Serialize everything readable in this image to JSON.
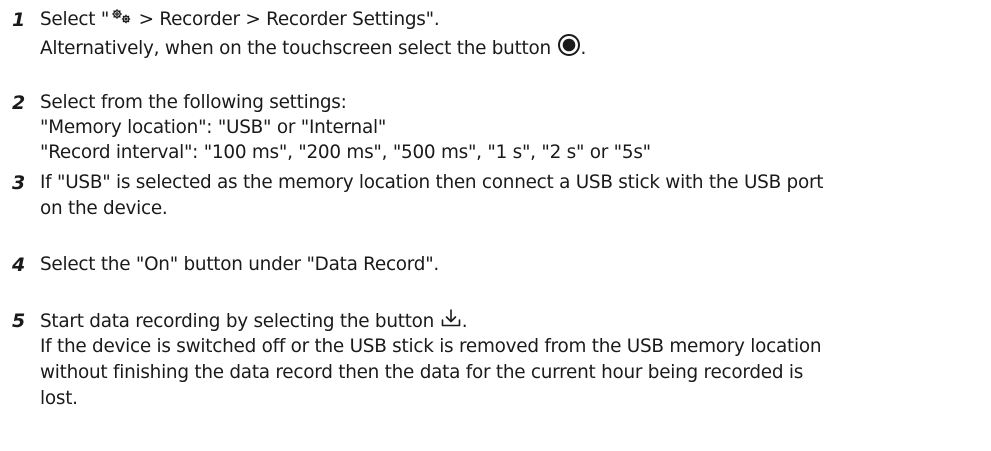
{
  "steps": [
    {
      "number": "1",
      "lines": [
        {
          "pre": "Select \"",
          "post": " > Recorder > Recorder Settings\"."
        },
        {
          "pre": "Alternatively, when on the touchscreen select the button ",
          "post": "."
        }
      ]
    },
    {
      "number": "2",
      "lines": [
        "Select from the following settings:",
        "\"Memory location\": \"USB\" or \"Internal\"",
        "\"Record interval\": \"100 ms\", \"200 ms\", \"500 ms\", \"1 s\", \"2 s\" or \"5s\""
      ]
    },
    {
      "number": "3",
      "lines": [
        "If \"USB\" is selected as the memory location then connect a USB stick with the USB port",
        "on the device."
      ]
    },
    {
      "number": "4",
      "lines": [
        "Select the \"On\" button under \"Data Record\"."
      ]
    },
    {
      "number": "5",
      "lines": [
        {
          "pre": "Start data recording by selecting the button ",
          "post": "."
        },
        "If the device is switched off or the USB stick is removed from the USB memory location",
        "without finishing the data record then the data for the current hour being recorded is",
        "lost."
      ]
    }
  ],
  "icons": {
    "settings": "gears-icon",
    "record": "record-button-icon",
    "download": "download-icon"
  }
}
